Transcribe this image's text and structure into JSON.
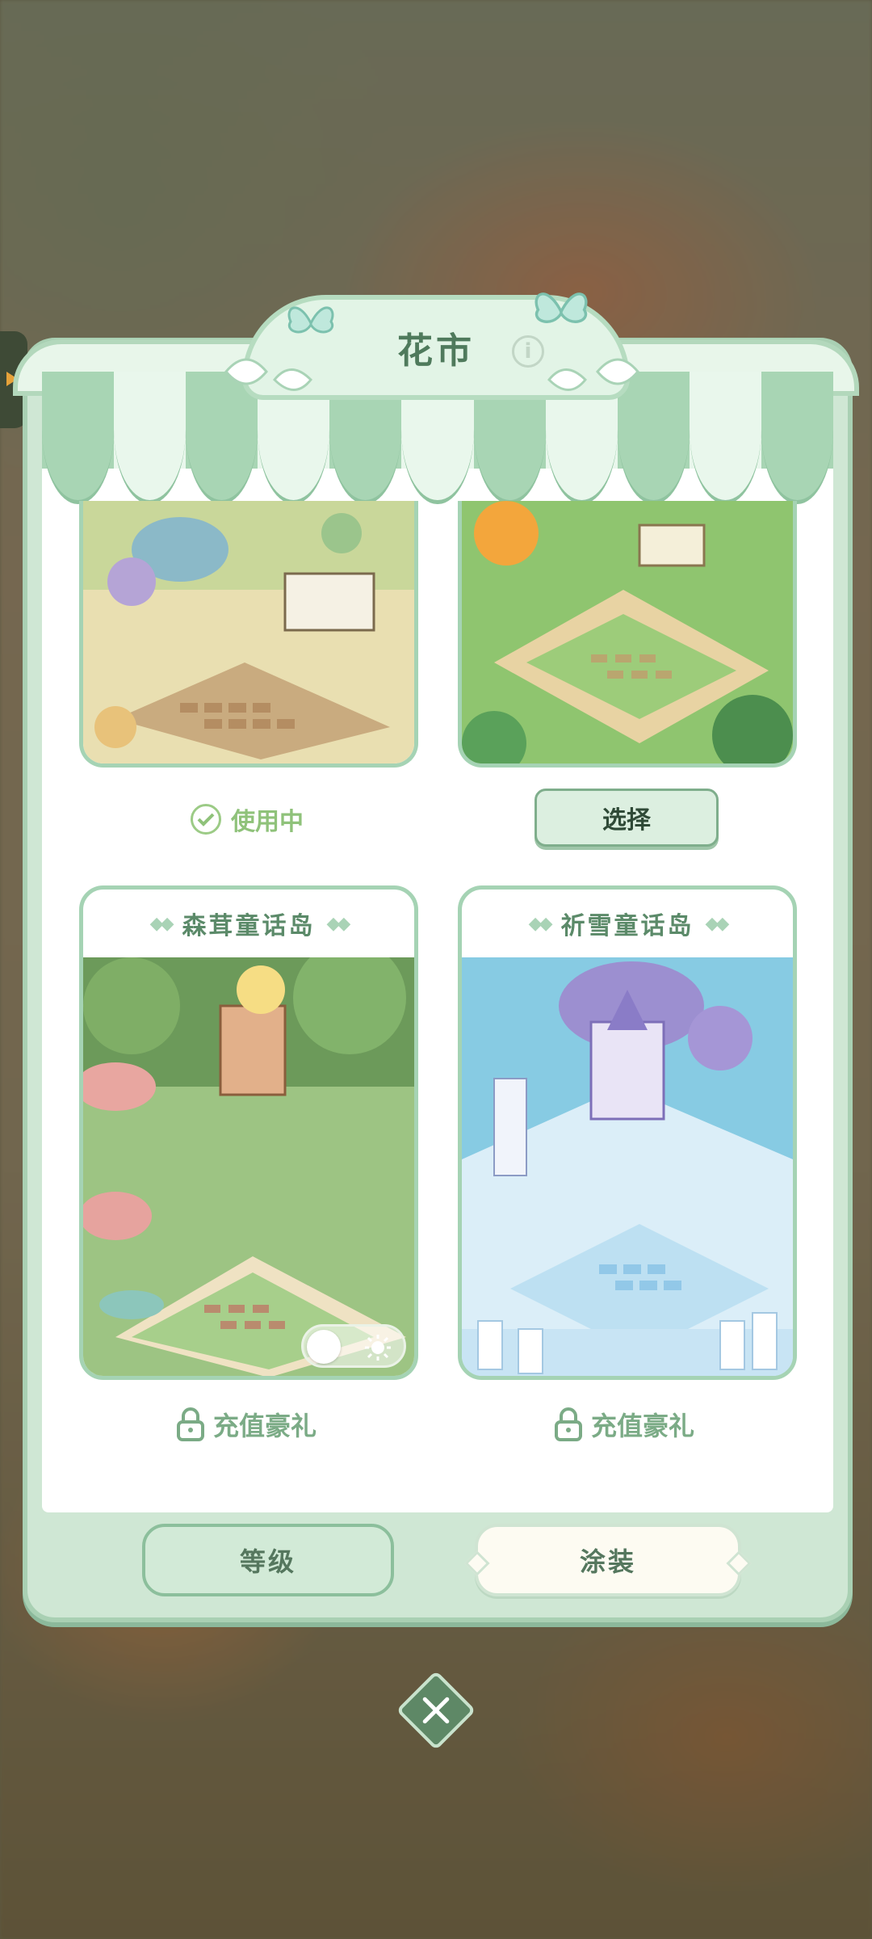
{
  "dialog": {
    "title": "花市"
  },
  "cards": [
    {
      "name": "",
      "status": "使用中"
    },
    {
      "name": "",
      "action": "选择"
    },
    {
      "name": "森茸童话岛",
      "status": "充值豪礼"
    },
    {
      "name": "祈雪童话岛",
      "status": "充值豪礼"
    }
  ],
  "tabs": {
    "level": "等级",
    "skin": "涂装"
  },
  "colors": {
    "panel_bg": "#cfe7d4",
    "accent_green": "#5b8a69",
    "in_use_green": "#8fc27a"
  }
}
